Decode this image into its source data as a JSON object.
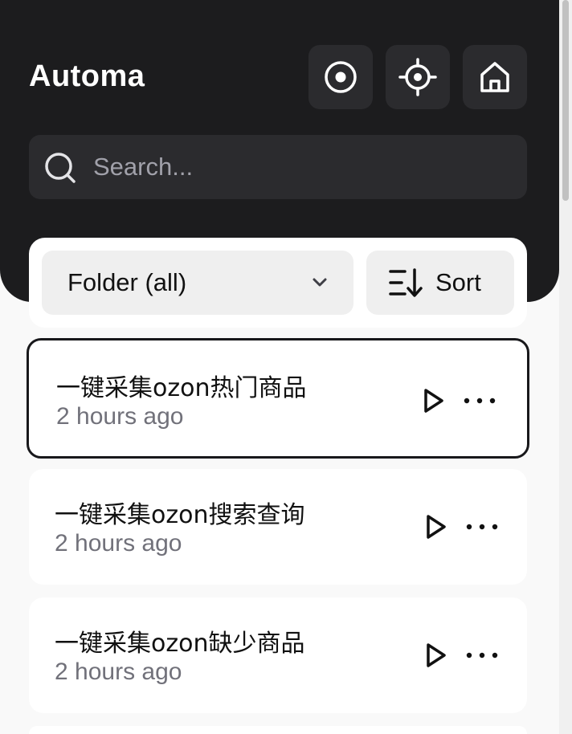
{
  "app": {
    "title": "Automa"
  },
  "header": {
    "buttons": [
      {
        "icon": "record-icon"
      },
      {
        "icon": "crosshair-icon"
      },
      {
        "icon": "home-icon"
      }
    ]
  },
  "search": {
    "placeholder": "Search...",
    "value": "",
    "icon": "search-icon"
  },
  "filters": {
    "folder_label": "Folder (all)",
    "sort_label": "Sort"
  },
  "workflows": [
    {
      "name": "一键采集ozon热门商品",
      "time": "2 hours ago",
      "active": true
    },
    {
      "name": "一键采集ozon搜索查询",
      "time": "2 hours ago",
      "active": false
    },
    {
      "name": "一键采集ozon缺少商品",
      "time": "2 hours ago",
      "active": false
    }
  ],
  "colors": {
    "header_bg": "#1c1c1e",
    "button_bg": "#2b2b2e",
    "muted_text": "#71717a",
    "active_border": "#18181b"
  }
}
